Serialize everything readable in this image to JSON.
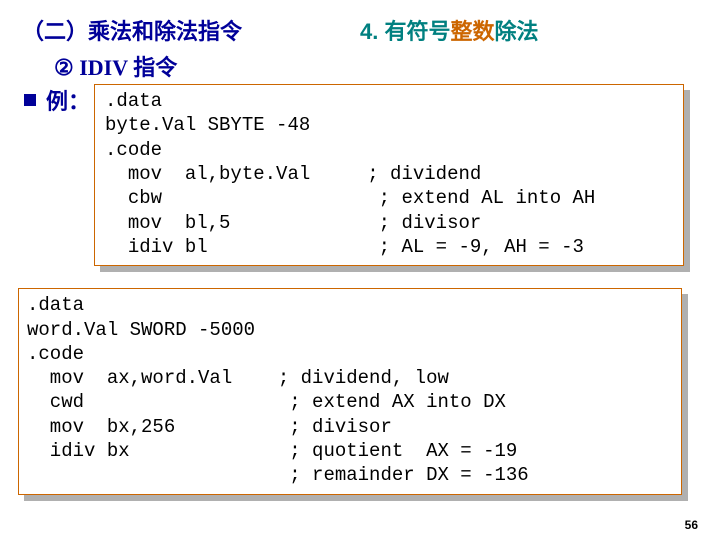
{
  "header": {
    "section_left": "（二）乘法和除法指令",
    "section_sub_num": "②",
    "section_sub_text": "IDIV 指令",
    "sec_right_num": "4.",
    "sec_right_a": "有符号",
    "sec_right_b": "整数",
    "sec_right_c": "除法"
  },
  "example_label": "例：",
  "code1": ".data\nbyte.Val SBYTE -48\n.code\n  mov  al,byte.Val     ; dividend\n  cbw                   ; extend AL into AH\n  mov  bl,5             ; divisor\n  idiv bl               ; AL = -9, AH = -3",
  "code2": ".data\nword.Val SWORD -5000\n.code\n  mov  ax,word.Val    ; dividend, low\n  cwd                  ; extend AX into DX\n  mov  bx,256          ; divisor\n  idiv bx              ; quotient  AX = -19\n                       ; remainder DX = -136",
  "page_number": "56"
}
